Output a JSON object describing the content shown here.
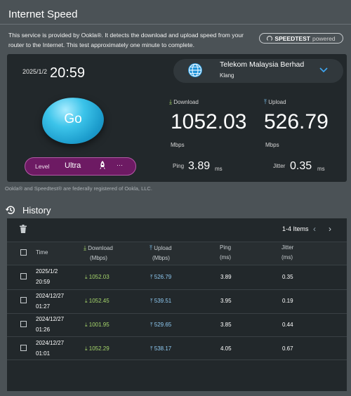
{
  "header": {
    "title": "Internet Speed",
    "description": "This service is provided by Ookla®. It detects the download and upload speed from your router to the Internet. This test approximately one minute to complete.",
    "badge_brand": "SPEEDTEST",
    "badge_suffix": "powered"
  },
  "test": {
    "date": "2025/1/2",
    "time": "20:59",
    "isp_name": "Telekom Malaysia Berhad",
    "isp_city": "Klang",
    "go_label": "Go",
    "download_label": "Download",
    "download_value": "1052.03",
    "download_unit": "Mbps",
    "upload_label": "Upload",
    "upload_value": "526.79",
    "upload_unit": "Mbps",
    "level_label": "Level",
    "level_value": "Ultra",
    "more_label": "···",
    "ping_label": "Ping",
    "ping_value": "3.89",
    "ping_unit": "ms",
    "jitter_label": "Jitter",
    "jitter_value": "0.35",
    "jitter_unit": "ms",
    "disclaimer": "Ookla® and Speedtest® are federally registered of Ookla, LLC."
  },
  "history": {
    "title": "History",
    "pager": "1-4 Items",
    "columns": {
      "time": "Time",
      "download": "Download",
      "download_unit": "(Mbps)",
      "upload": "Upload",
      "upload_unit": "(Mbps)",
      "ping": "Ping",
      "ping_unit": "(ms)",
      "jitter": "Jitter",
      "jitter_unit": "(ms)"
    },
    "rows": [
      {
        "date": "2025/1/2",
        "time": "20:59",
        "download": "1052.03",
        "upload": "526.79",
        "ping": "3.89",
        "jitter": "0.35"
      },
      {
        "date": "2024/12/27",
        "time": "01:27",
        "download": "1052.45",
        "upload": "539.51",
        "ping": "3.95",
        "jitter": "0.19"
      },
      {
        "date": "2024/12/27",
        "time": "01:26",
        "download": "1001.95",
        "upload": "529.65",
        "ping": "3.85",
        "jitter": "0.44"
      },
      {
        "date": "2024/12/27",
        "time": "01:01",
        "download": "1052.29",
        "upload": "538.17",
        "ping": "4.05",
        "jitter": "0.67"
      }
    ]
  },
  "icons": {
    "isp": "globe-icon",
    "dropdown": "chevron-down-icon",
    "rocket": "rocket-icon",
    "history": "history-icon",
    "delete": "trash-icon",
    "download": "download-arrow-icon",
    "upload": "upload-arrow-icon"
  },
  "colors": {
    "accent": "#1c9ccc",
    "download": "#a6d66b",
    "upload": "#8fcaf2",
    "level_bg": "#6d1a63"
  }
}
